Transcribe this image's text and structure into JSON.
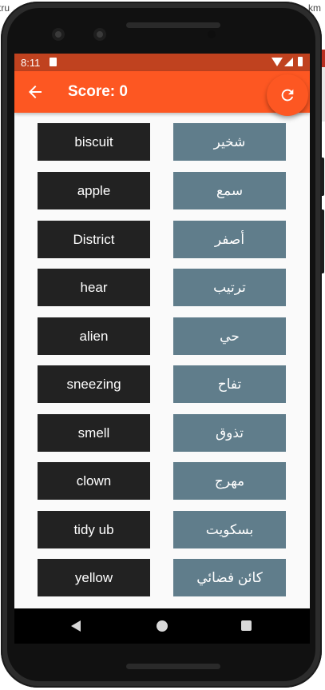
{
  "background": {
    "left_fragment": "tru",
    "right_fragment": "km"
  },
  "status_bar": {
    "time": "8:11"
  },
  "app_bar": {
    "title": "Score: 0",
    "back_icon": "arrow-left-icon",
    "refresh_icon": "refresh-icon"
  },
  "colors": {
    "accent": "#fd5722",
    "status_bar": "#c0421f",
    "english_tile": "#222222",
    "arabic_tile": "#607d8b"
  },
  "words": {
    "english": [
      "biscuit",
      "apple",
      "District",
      "hear",
      "alien",
      "sneezing",
      "smell",
      "clown",
      "tidy ub",
      "yellow"
    ],
    "arabic": [
      "شخير",
      "سمع",
      "أصفر",
      "ترتيب",
      "حي",
      "تفاح",
      "تذوق",
      "مهرج",
      "بسكويت",
      "كائن فضائي"
    ]
  }
}
